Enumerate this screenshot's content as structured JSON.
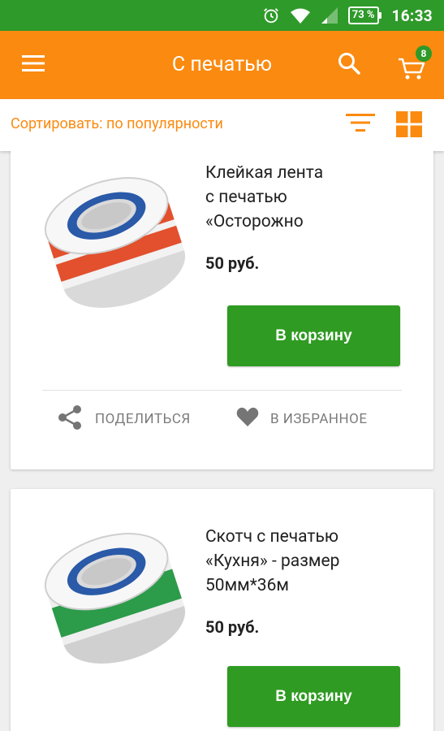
{
  "status_bar": {
    "battery": "73 %",
    "time": "16:33",
    "icons": [
      "alarm-icon",
      "wifi-icon",
      "signal-icon",
      "battery-icon"
    ]
  },
  "app_bar": {
    "title": "С печатью",
    "cart_count": "8",
    "icons": [
      "menu-icon",
      "search-icon",
      "cart-icon"
    ],
    "background": "#fb8a10"
  },
  "sort_bar": {
    "label": "Сортировать: по популярности",
    "icons": [
      "filter-icon",
      "grid-view-icon"
    ]
  },
  "products": [
    {
      "title": "Клейкая лента\nс печатью\n«Осторожно",
      "price": "50 руб.",
      "add_to_cart": "В корзину",
      "share_label": "ПОДЕЛИТЬСЯ",
      "favorite_label": "В ИЗБРАННОЕ",
      "tape_color": "#e2502d"
    },
    {
      "title": "Скотч с печатью\n«Кухня» - размер\n50мм*36м",
      "price": "50 руб.",
      "add_to_cart": "В корзину",
      "tape_color": "#2c9b4a"
    }
  ],
  "colors": {
    "status_green": "#2e9a2a",
    "accent_orange": "#fb8a10",
    "button_green": "#2f9b22"
  }
}
